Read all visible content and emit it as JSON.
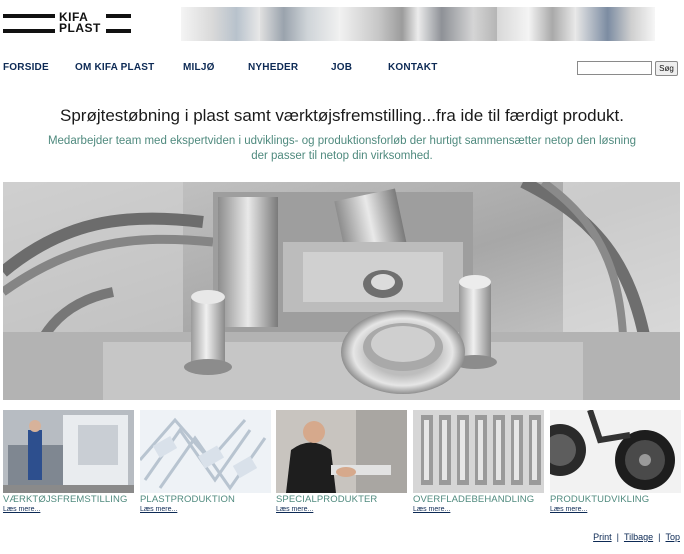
{
  "logo": {
    "line1": "KIFA",
    "line2": "PLAST"
  },
  "nav": {
    "items": [
      {
        "label": "FORSIDE"
      },
      {
        "label": "OM KIFA PLAST"
      },
      {
        "label": "MILJØ"
      },
      {
        "label": "NYHEDER"
      },
      {
        "label": "JOB"
      },
      {
        "label": "KONTAKT"
      }
    ]
  },
  "search": {
    "placeholder": "",
    "button_label": "Søg"
  },
  "hero": {
    "headline": "Sprøjtestøbning i plast samt værktøjsfremstilling...fra ide til færdigt produkt.",
    "subline": "Medarbejder team med ekspertviden i udviklings- og produktionsforløb der hurtigt sammensætter netop den løsning der passer til netop din virksomhed."
  },
  "thumbs": [
    {
      "label": "VÆRKTØJSFREMSTILLING",
      "more": "Læs mere..."
    },
    {
      "label": "PLASTPRODUKTION",
      "more": "Læs mere..."
    },
    {
      "label": "SPECIALPRODUKTER",
      "more": "Læs mere..."
    },
    {
      "label": "OVERFLADEBEHANDLING",
      "more": "Læs mere..."
    },
    {
      "label": "PRODUKTUDVIKLING",
      "more": "Læs mere..."
    }
  ],
  "footer": {
    "print": "Print",
    "back": "Tilbage",
    "top": "Top"
  },
  "colors": {
    "nav": "#0d2a55",
    "accent_text": "#4f8a7e"
  }
}
